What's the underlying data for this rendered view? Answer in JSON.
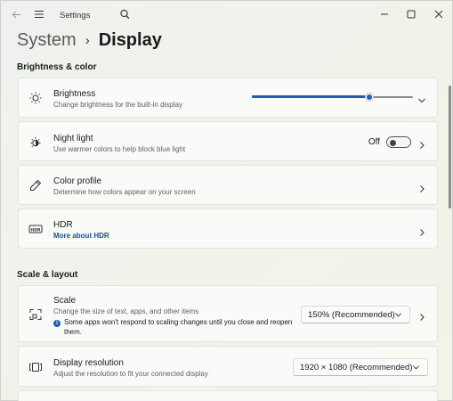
{
  "window": {
    "title": "Settings",
    "back_icon": "back-arrow-icon",
    "menu_icon": "hamburger-menu-icon",
    "search_icon": "search-icon"
  },
  "breadcrumb": {
    "parent": "System",
    "separator": "›",
    "current": "Display"
  },
  "brightness_color": {
    "heading": "Brightness & color",
    "brightness": {
      "title": "Brightness",
      "desc": "Change brightness for the built-in display",
      "level_percent": 74
    },
    "night_light": {
      "title": "Night light",
      "desc": "Use warmer colors to help block blue light",
      "state": "Off"
    },
    "color_profile": {
      "title": "Color profile",
      "desc": "Determine how colors appear on your screen"
    },
    "hdr": {
      "title": "HDR",
      "link": "More about HDR"
    }
  },
  "scale_layout": {
    "heading": "Scale & layout",
    "scale": {
      "title": "Scale",
      "desc": "Change the size of text, apps, and other items",
      "info": "Some apps won't respond to scaling changes until you close and reopen them.",
      "value": "150% (Recommended)"
    },
    "resolution": {
      "title": "Display resolution",
      "desc": "Adjust the resolution to fit your connected display",
      "value": "1920 × 1080 (Recommended)"
    }
  },
  "colors": {
    "accent": "#1c5fb4",
    "link": "#1a4f9c"
  }
}
